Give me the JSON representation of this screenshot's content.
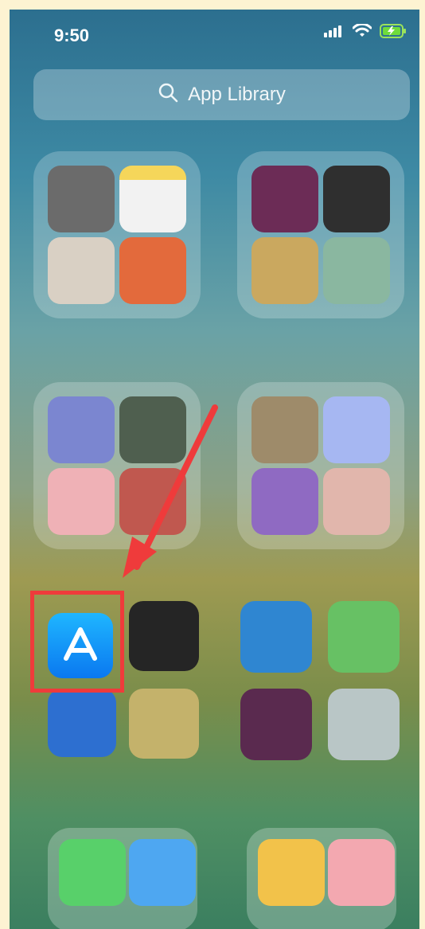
{
  "status_bar": {
    "time": "9:50",
    "icons": [
      "signal-icon",
      "wifi-icon",
      "battery-charging-icon"
    ]
  },
  "search": {
    "placeholder": "App Library",
    "icon": "search-icon"
  },
  "highlight": {
    "target": "app-store-icon",
    "color": "#ef3b3b"
  },
  "colors": {
    "accent_annotation": "#ef3b3b",
    "app_store_gradient_top": "#1fb6ff",
    "app_store_gradient_bottom": "#0a78f0"
  }
}
